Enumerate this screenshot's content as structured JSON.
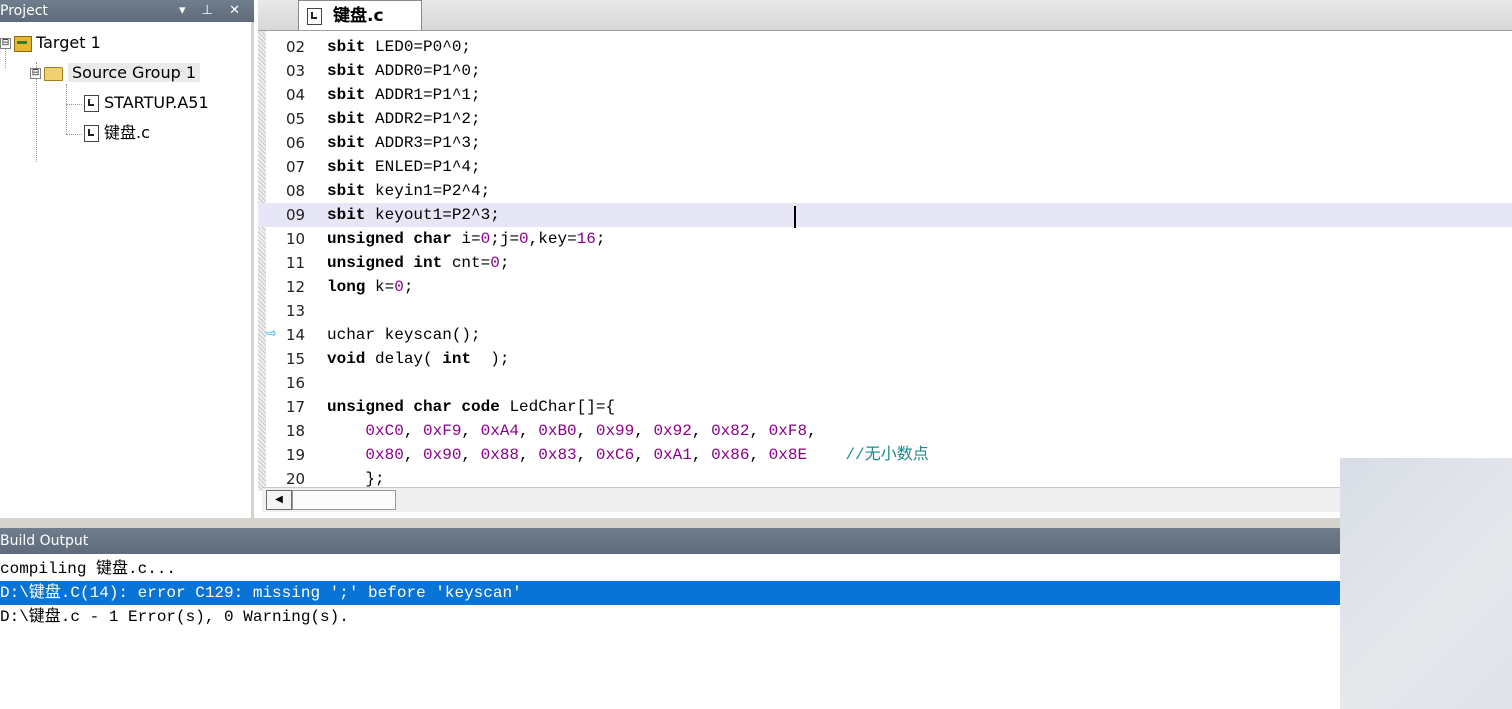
{
  "project": {
    "title": "Project",
    "controls": "▾ ⊥ ✕",
    "tree": [
      {
        "label": "Target 1",
        "toggle": "⊟"
      },
      {
        "label": "Source Group 1",
        "toggle": "⊟"
      },
      {
        "label": "STARTUP.A51"
      },
      {
        "label": "键盘.c"
      }
    ]
  },
  "editor": {
    "tab_label": "键盘.c",
    "lines": [
      {
        "no": "02",
        "parts": [
          [
            "kw",
            "sbit"
          ],
          [
            "",
            "LED0=P0^0;"
          ]
        ]
      },
      {
        "no": "03",
        "parts": [
          [
            "kw",
            "sbit"
          ],
          [
            "",
            "ADDR0=P1^0;"
          ]
        ]
      },
      {
        "no": "04",
        "parts": [
          [
            "kw",
            "sbit"
          ],
          [
            "",
            "ADDR1=P1^1;"
          ]
        ]
      },
      {
        "no": "05",
        "parts": [
          [
            "kw",
            "sbit"
          ],
          [
            "",
            "ADDR2=P1^2;"
          ]
        ]
      },
      {
        "no": "06",
        "parts": [
          [
            "kw",
            "sbit"
          ],
          [
            "",
            "ADDR3=P1^3;"
          ]
        ]
      },
      {
        "no": "07",
        "parts": [
          [
            "kw",
            "sbit"
          ],
          [
            "",
            "ENLED=P1^4;"
          ]
        ]
      },
      {
        "no": "08",
        "parts": [
          [
            "kw",
            "sbit"
          ],
          [
            "",
            "keyin1=P2^4;"
          ]
        ]
      },
      {
        "no": "09",
        "parts": [
          [
            "kw",
            "sbit"
          ],
          [
            "",
            "keyout1=P2^3;"
          ]
        ]
      },
      {
        "no": "10",
        "parts": [
          [
            "kw",
            "unsigned char"
          ],
          [
            "",
            "i="
          ],
          [
            "num",
            "0"
          ],
          [
            "",
            ";j="
          ],
          [
            "num",
            "0"
          ],
          [
            "",
            ",key="
          ],
          [
            "num",
            "16"
          ],
          [
            "",
            ";"
          ]
        ]
      },
      {
        "no": "11",
        "parts": [
          [
            "kw",
            "unsigned int"
          ],
          [
            "",
            "cnt="
          ],
          [
            "num",
            "0"
          ],
          [
            "",
            ";"
          ]
        ]
      },
      {
        "no": "12",
        "parts": [
          [
            "kw",
            "long"
          ],
          [
            "",
            "k="
          ],
          [
            "num",
            "0"
          ],
          [
            "",
            ";"
          ]
        ]
      },
      {
        "no": "13",
        "parts": []
      },
      {
        "no": "14",
        "parts": [
          [
            "",
            "uchar keyscan();"
          ]
        ]
      },
      {
        "no": "15",
        "parts": [
          [
            "kw",
            "void"
          ],
          [
            "",
            "delay( "
          ],
          [
            "kw",
            "int"
          ],
          [
            "",
            " );"
          ]
        ]
      },
      {
        "no": "16",
        "parts": []
      },
      {
        "no": "17",
        "parts": [
          [
            "kw",
            "unsigned char code"
          ],
          [
            "",
            "LedChar[]={"
          ]
        ]
      },
      {
        "no": "18",
        "parts": [
          [
            "",
            "    "
          ],
          [
            "num",
            "0xC0"
          ],
          [
            "",
            ", "
          ],
          [
            "num",
            "0xF9"
          ],
          [
            "",
            ", "
          ],
          [
            "num",
            "0xA4"
          ],
          [
            "",
            ", "
          ],
          [
            "num",
            "0xB0"
          ],
          [
            "",
            ", "
          ],
          [
            "num",
            "0x99"
          ],
          [
            "",
            ", "
          ],
          [
            "num",
            "0x92"
          ],
          [
            "",
            ", "
          ],
          [
            "num",
            "0x82"
          ],
          [
            "",
            ", "
          ],
          [
            "num",
            "0xF8"
          ],
          [
            "",
            ","
          ]
        ]
      },
      {
        "no": "19",
        "parts": [
          [
            "",
            "    "
          ],
          [
            "num",
            "0x80"
          ],
          [
            "",
            ", "
          ],
          [
            "num",
            "0x90"
          ],
          [
            "",
            ", "
          ],
          [
            "num",
            "0x88"
          ],
          [
            "",
            ", "
          ],
          [
            "num",
            "0x83"
          ],
          [
            "",
            ", "
          ],
          [
            "num",
            "0xC6"
          ],
          [
            "",
            ", "
          ],
          [
            "num",
            "0xA1"
          ],
          [
            "",
            ", "
          ],
          [
            "num",
            "0x86"
          ],
          [
            "",
            ", "
          ],
          [
            "num",
            "0x8E"
          ],
          [
            "",
            "    "
          ],
          [
            "cmt",
            "//无小数点"
          ]
        ]
      },
      {
        "no": "20",
        "parts": [
          [
            "",
            "    };"
          ]
        ]
      }
    ],
    "current_line": "09",
    "arrow_line": "14"
  },
  "build": {
    "title": "Build Output",
    "lines": [
      "compiling 键盘.c...",
      "D:\\键盘.C(14): error C129: missing ';' before 'keyscan'",
      "D:\\键盘.c - 1 Error(s), 0 Warning(s)."
    ],
    "selected_index": 1
  }
}
